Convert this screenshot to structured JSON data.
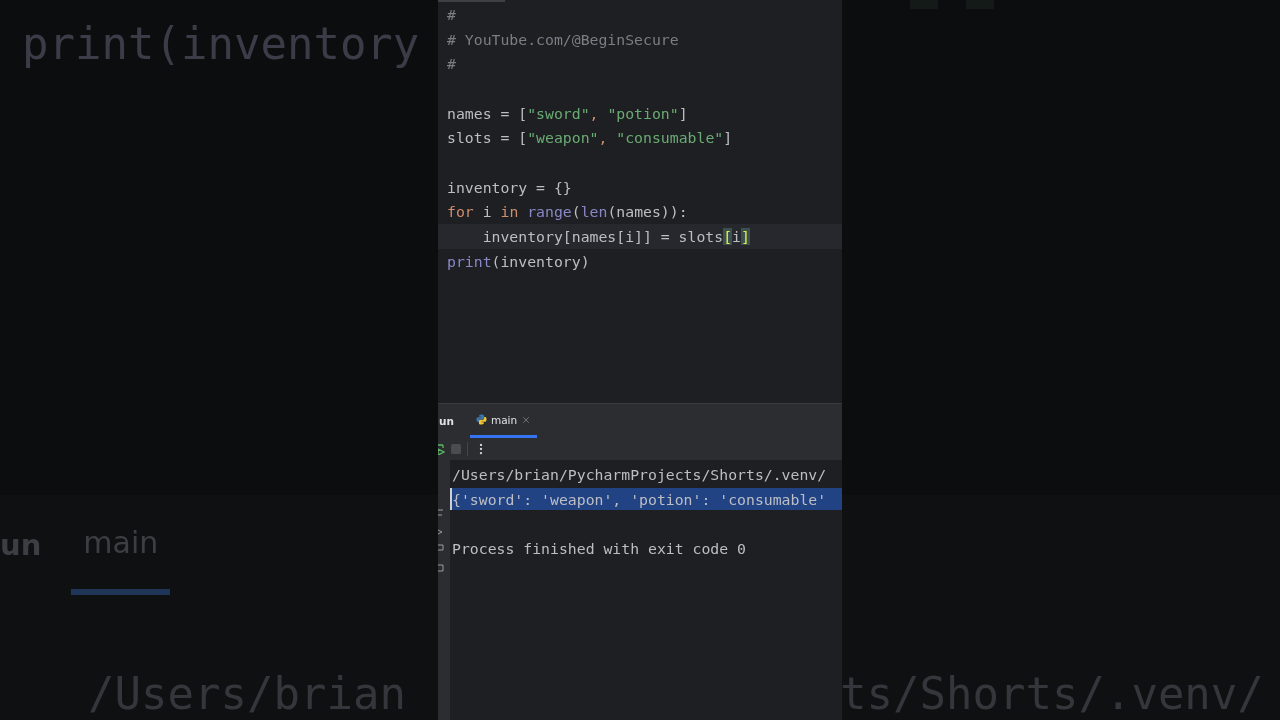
{
  "backdrop": {
    "left": {
      "code": "print(inventory",
      "run_label": "un",
      "tab_label": "main",
      "path": "/Users/brian"
    },
    "right": {
      "path": "ts/Shorts/.venv/"
    }
  },
  "editor": {
    "lines": [
      {
        "kind": "code",
        "current": false,
        "tokens": [
          {
            "kind": "comment",
            "text": "#"
          }
        ]
      },
      {
        "kind": "code",
        "current": false,
        "tokens": [
          {
            "kind": "comment",
            "text": "# YouTube.com/@BeginSecure"
          }
        ]
      },
      {
        "kind": "code",
        "current": false,
        "tokens": [
          {
            "kind": "comment",
            "text": "#"
          }
        ]
      },
      {
        "kind": "blank",
        "current": false
      },
      {
        "kind": "code",
        "current": false,
        "tokens": [
          {
            "kind": "plain",
            "text": "names = ["
          },
          {
            "kind": "string",
            "text": "\"sword\""
          },
          {
            "kind": "punct",
            "text": ", "
          },
          {
            "kind": "string",
            "text": "\"potion\""
          },
          {
            "kind": "plain",
            "text": "]"
          }
        ]
      },
      {
        "kind": "code",
        "current": false,
        "tokens": [
          {
            "kind": "plain",
            "text": "slots = ["
          },
          {
            "kind": "string",
            "text": "\"weapon\""
          },
          {
            "kind": "punct",
            "text": ", "
          },
          {
            "kind": "string",
            "text": "\"consumable\""
          },
          {
            "kind": "plain",
            "text": "]"
          }
        ]
      },
      {
        "kind": "blank",
        "current": false
      },
      {
        "kind": "code",
        "current": false,
        "tokens": [
          {
            "kind": "plain",
            "text": "inventory = {}"
          }
        ]
      },
      {
        "kind": "code",
        "current": false,
        "tokens": [
          {
            "kind": "keyword",
            "text": "for"
          },
          {
            "kind": "plain",
            "text": " i "
          },
          {
            "kind": "keyword",
            "text": "in"
          },
          {
            "kind": "builtin",
            "text": " range"
          },
          {
            "kind": "plain",
            "text": "("
          },
          {
            "kind": "builtin",
            "text": "len"
          },
          {
            "kind": "plain",
            "text": "(names)):"
          }
        ]
      },
      {
        "kind": "code",
        "current": true,
        "tokens": [
          {
            "kind": "plain",
            "text": "    inventory[names[i]] = slots"
          },
          {
            "kind": "match",
            "text": "["
          },
          {
            "kind": "plain",
            "text": "i"
          },
          {
            "kind": "match",
            "text": "]"
          }
        ]
      },
      {
        "kind": "code",
        "current": false,
        "tokens": [
          {
            "kind": "builtin",
            "text": "print"
          },
          {
            "kind": "plain",
            "text": "(inventory)"
          }
        ]
      }
    ]
  },
  "run_panel": {
    "title": "un",
    "tabs": [
      {
        "label": "main",
        "selected": true
      }
    ],
    "console": [
      {
        "kind": "text",
        "selected": false,
        "text": "/Users/brian/PycharmProjects/Shorts/.venv/"
      },
      {
        "kind": "text",
        "selected": true,
        "text": "{'sword': 'weapon', 'potion': 'consumable'"
      },
      {
        "kind": "blank",
        "selected": false
      },
      {
        "kind": "text",
        "selected": false,
        "text": "Process finished with exit code 0"
      }
    ]
  }
}
